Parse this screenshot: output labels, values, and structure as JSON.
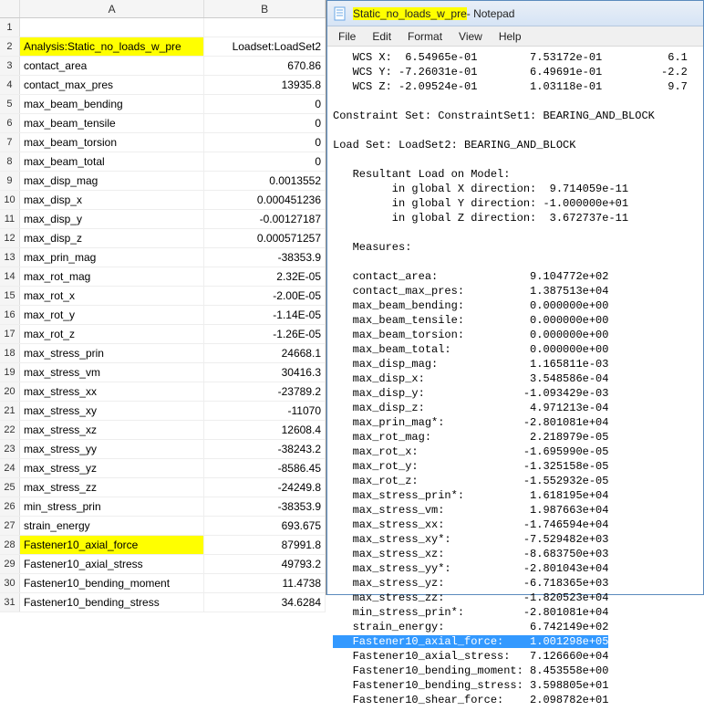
{
  "excel": {
    "columns": {
      "A": "A",
      "B": "B"
    },
    "rows": [
      {
        "n": "1",
        "a": "",
        "b": "",
        "hlA": false
      },
      {
        "n": "2",
        "a": "Analysis:Static_no_loads_w_pre",
        "b": "Loadset:LoadSet2",
        "hlA": true
      },
      {
        "n": "3",
        "a": "contact_area",
        "b": "670.86",
        "hlA": false
      },
      {
        "n": "4",
        "a": "contact_max_pres",
        "b": "13935.8",
        "hlA": false
      },
      {
        "n": "5",
        "a": "max_beam_bending",
        "b": "0",
        "hlA": false
      },
      {
        "n": "6",
        "a": "max_beam_tensile",
        "b": "0",
        "hlA": false
      },
      {
        "n": "7",
        "a": "max_beam_torsion",
        "b": "0",
        "hlA": false
      },
      {
        "n": "8",
        "a": "max_beam_total",
        "b": "0",
        "hlA": false
      },
      {
        "n": "9",
        "a": "max_disp_mag",
        "b": "0.0013552",
        "hlA": false
      },
      {
        "n": "10",
        "a": "max_disp_x",
        "b": "0.000451236",
        "hlA": false
      },
      {
        "n": "11",
        "a": "max_disp_y",
        "b": "-0.00127187",
        "hlA": false
      },
      {
        "n": "12",
        "a": "max_disp_z",
        "b": "0.000571257",
        "hlA": false
      },
      {
        "n": "13",
        "a": "max_prin_mag",
        "b": "-38353.9",
        "hlA": false
      },
      {
        "n": "14",
        "a": "max_rot_mag",
        "b": "2.32E-05",
        "hlA": false
      },
      {
        "n": "15",
        "a": "max_rot_x",
        "b": "-2.00E-05",
        "hlA": false
      },
      {
        "n": "16",
        "a": "max_rot_y",
        "b": "-1.14E-05",
        "hlA": false
      },
      {
        "n": "17",
        "a": "max_rot_z",
        "b": "-1.26E-05",
        "hlA": false
      },
      {
        "n": "18",
        "a": "max_stress_prin",
        "b": "24668.1",
        "hlA": false
      },
      {
        "n": "19",
        "a": "max_stress_vm",
        "b": "30416.3",
        "hlA": false
      },
      {
        "n": "20",
        "a": "max_stress_xx",
        "b": "-23789.2",
        "hlA": false
      },
      {
        "n": "21",
        "a": "max_stress_xy",
        "b": "-11070",
        "hlA": false
      },
      {
        "n": "22",
        "a": "max_stress_xz",
        "b": "12608.4",
        "hlA": false
      },
      {
        "n": "23",
        "a": "max_stress_yy",
        "b": "-38243.2",
        "hlA": false
      },
      {
        "n": "24",
        "a": "max_stress_yz",
        "b": "-8586.45",
        "hlA": false
      },
      {
        "n": "25",
        "a": "max_stress_zz",
        "b": "-24249.8",
        "hlA": false
      },
      {
        "n": "26",
        "a": "min_stress_prin",
        "b": "-38353.9",
        "hlA": false
      },
      {
        "n": "27",
        "a": "strain_energy",
        "b": "693.675",
        "hlA": false
      },
      {
        "n": "28",
        "a": "Fastener10_axial_force",
        "b": "87991.8",
        "hlA": true
      },
      {
        "n": "29",
        "a": "Fastener10_axial_stress",
        "b": "49793.2",
        "hlA": false
      },
      {
        "n": "30",
        "a": "Fastener10_bending_moment",
        "b": "11.4738",
        "hlA": false
      },
      {
        "n": "31",
        "a": "Fastener10_bending_stress",
        "b": "34.6284",
        "hlA": false
      }
    ]
  },
  "notepad": {
    "title_hl": "Static_no_loads_w_pre",
    "title_suffix": " - Notepad",
    "menu": [
      "File",
      "Edit",
      "Format",
      "View",
      "Help"
    ],
    "lines": [
      "   WCS X:  6.54965e-01        7.53172e-01          6.1",
      "   WCS Y: -7.26031e-01        6.49691e-01         -2.2",
      "   WCS Z: -2.09524e-01        1.03118e-01          9.7",
      "",
      "Constraint Set: ConstraintSet1: BEARING_AND_BLOCK",
      "",
      "Load Set: LoadSet2: BEARING_AND_BLOCK",
      "",
      "   Resultant Load on Model:",
      "         in global X direction:  9.714059e-11",
      "         in global Y direction: -1.000000e+01",
      "         in global Z direction:  3.672737e-11",
      "",
      "   Measures:",
      "",
      "   contact_area:              9.104772e+02",
      "   contact_max_pres:          1.387513e+04",
      "   max_beam_bending:          0.000000e+00",
      "   max_beam_tensile:          0.000000e+00",
      "   max_beam_torsion:          0.000000e+00",
      "   max_beam_total:            0.000000e+00",
      "   max_disp_mag:              1.165811e-03",
      "   max_disp_x:                3.548586e-04",
      "   max_disp_y:               -1.093429e-03",
      "   max_disp_z:                4.971213e-04",
      "   max_prin_mag*:            -2.801081e+04",
      "   max_rot_mag:               2.218979e-05",
      "   max_rot_x:                -1.695990e-05",
      "   max_rot_y:                -1.325158e-05",
      "   max_rot_z:                -1.552932e-05",
      "   max_stress_prin*:          1.618195e+04",
      "   max_stress_vm:             1.987663e+04",
      "   max_stress_xx:            -1.746594e+04",
      "   max_stress_xy*:           -7.529482e+03",
      "   max_stress_xz:            -8.683750e+03",
      "   max_stress_yy*:           -2.801043e+04",
      "   max_stress_yz:            -6.718365e+03",
      "   max_stress_zz:            -1.820523e+04",
      "   min_stress_prin*:         -2.801081e+04",
      "   strain_energy:             6.742149e+02"
    ],
    "selected": {
      "label": "   Fastener10_axial_force:    1.001298e+05"
    },
    "lines_after": [
      "   Fastener10_axial_stress:   7.126660e+04",
      "   Fastener10_bending_moment: 8.453558e+00",
      "   Fastener10_bending_stress: 3.598805e+01",
      "   Fastener10_shear_force:    2.098782e+01"
    ]
  }
}
